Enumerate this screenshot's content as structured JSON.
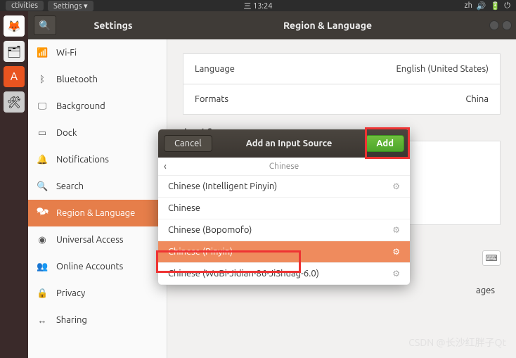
{
  "top_panel": {
    "activities": "ctivities",
    "app_indicator": "Settings ▾",
    "clock": "三 13:24",
    "tray": [
      "zh",
      "🔊",
      "🔋",
      "⏻"
    ]
  },
  "window": {
    "title_left": "Settings",
    "title_right": "Region & Language"
  },
  "sidebar": {
    "items": [
      {
        "icon": "📶",
        "label": "Wi-Fi"
      },
      {
        "icon": "ᛒ",
        "label": "Bluetooth"
      },
      {
        "icon": "🖵",
        "label": "Background"
      },
      {
        "icon": "▭",
        "label": "Dock"
      },
      {
        "icon": "🔔",
        "label": "Notifications"
      },
      {
        "icon": "🔍",
        "label": "Search"
      },
      {
        "icon": "🗫",
        "label": "Region & Language"
      },
      {
        "icon": "◉",
        "label": "Universal Access"
      },
      {
        "icon": "👥",
        "label": "Online Accounts"
      },
      {
        "icon": "🔒",
        "label": "Privacy"
      },
      {
        "icon": "↔",
        "label": "Sharing"
      }
    ],
    "active_index": 6
  },
  "content": {
    "language_label": "Language",
    "language_value": "English (United States)",
    "formats_label": "Formats",
    "formats_value": "China",
    "input_sources_label": "Input Sources",
    "manage_label": "ages"
  },
  "dialog": {
    "cancel": "Cancel",
    "title": "Add an Input Source",
    "add": "Add",
    "list_header": "Chinese",
    "items": [
      {
        "label": "Chinese (Intelligent Pinyin)",
        "gear": true,
        "selected": false
      },
      {
        "label": "Chinese",
        "gear": false,
        "selected": false
      },
      {
        "label": "Chinese (Bopomofo)",
        "gear": true,
        "selected": false
      },
      {
        "label": "Chinese (Pinyin)",
        "gear": true,
        "selected": true
      },
      {
        "label": "Chinese (WuBi-Jidian-86-JiShuag-6.0)",
        "gear": true,
        "selected": false
      }
    ]
  },
  "watermark": "CSDN @长沙红胖子Qt"
}
